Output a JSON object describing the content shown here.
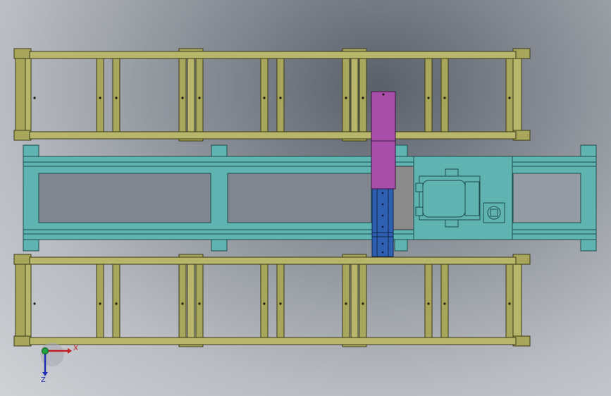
{
  "viewport": {
    "background": "gradient-gray",
    "colors": {
      "rack_frame": "#a8a65a",
      "rack_edge": "#3b3a18",
      "base_frame": "#5fb3b0",
      "base_edge": "#1e4e4c",
      "lift_column": "#a64ea8",
      "rail": "#2f5fb0",
      "carriage": "#5fb3b0",
      "motor_plate": "#8b8b8b"
    }
  },
  "triad": {
    "x_label": "X",
    "z_label": "Z",
    "x_color": "#c02020",
    "z_color": "#2030b0",
    "origin_color": "#20a040"
  }
}
